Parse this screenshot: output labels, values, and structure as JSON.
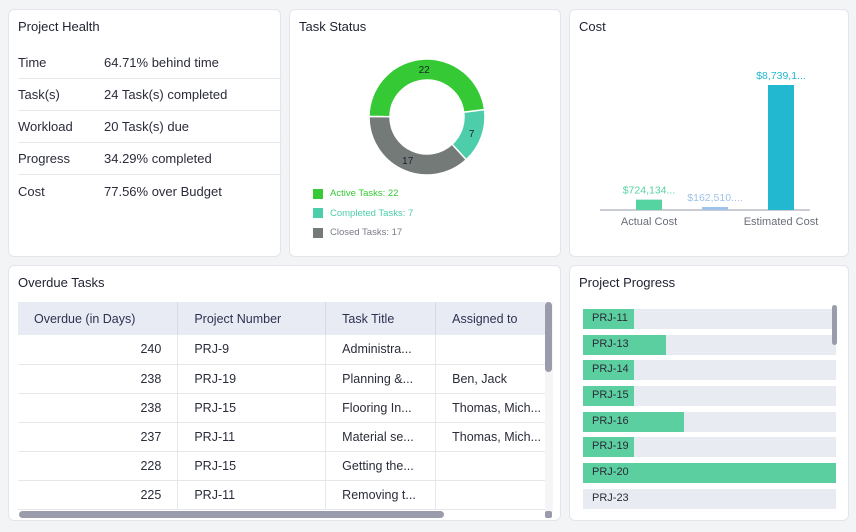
{
  "health": {
    "title": "Project Health",
    "rows": [
      {
        "label": "Time",
        "value": "64.71% behind time"
      },
      {
        "label": "Task(s)",
        "value": "24 Task(s) completed"
      },
      {
        "label": "Workload",
        "value": "20 Task(s) due"
      },
      {
        "label": "Progress",
        "value": "34.29% completed"
      },
      {
        "label": "Cost",
        "value": "77.56% over Budget"
      }
    ]
  },
  "task_status": {
    "title": "Task Status",
    "chart_data": {
      "type": "pie",
      "segments": [
        {
          "name": "Active Tasks",
          "value": 22,
          "color": "#35c935"
        },
        {
          "name": "Completed Tasks",
          "value": 7,
          "color": "#4ecdaa"
        },
        {
          "name": "Closed Tasks",
          "value": 17,
          "color": "#737a78"
        }
      ]
    },
    "legend": [
      {
        "label": "Active Tasks: 22",
        "color": "#35c935"
      },
      {
        "label": "Completed Tasks: 7",
        "color": "#4ecdaa"
      },
      {
        "label": "Closed Tasks: 17",
        "color": "#737a78"
      }
    ]
  },
  "cost": {
    "title": "Cost",
    "chart_data": {
      "type": "bar",
      "categories": [
        "Actual Cost",
        "Estimated Cost"
      ],
      "series": [
        {
          "values": [
            724134,
            8739100
          ],
          "labels": [
            "$724,134...",
            "$8,739,1..."
          ],
          "colors": [
            "#55d3a0",
            "#22b8cf"
          ]
        },
        {
          "values": [
            162510
          ],
          "labels": [
            "$162,510...."
          ],
          "colors": [
            "#9fc2e8"
          ]
        }
      ]
    }
  },
  "overdue": {
    "title": "Overdue Tasks",
    "columns": [
      "Overdue (in Days)",
      "Project Number",
      "Task Title",
      "Assigned to"
    ],
    "rows": [
      [
        "240",
        "PRJ-9",
        "Administra...",
        ""
      ],
      [
        "238",
        "PRJ-19",
        "Planning &...",
        "Ben, Jack"
      ],
      [
        "238",
        "PRJ-15",
        "Flooring In...",
        "Thomas, Mich..."
      ],
      [
        "237",
        "PRJ-11",
        "Material se...",
        "Thomas, Mich..."
      ],
      [
        "228",
        "PRJ-15",
        "Getting the...",
        ""
      ],
      [
        "225",
        "PRJ-11",
        "Removing t...",
        ""
      ]
    ]
  },
  "progress": {
    "title": "Project Progress",
    "items": [
      {
        "label": "PRJ-11",
        "pct": 20
      },
      {
        "label": "PRJ-13",
        "pct": 33
      },
      {
        "label": "PRJ-14",
        "pct": 20
      },
      {
        "label": "PRJ-15",
        "pct": 20
      },
      {
        "label": "PRJ-16",
        "pct": 40
      },
      {
        "label": "PRJ-19",
        "pct": 20
      },
      {
        "label": "PRJ-20",
        "pct": 100
      },
      {
        "label": "PRJ-23",
        "pct": 0
      }
    ]
  }
}
